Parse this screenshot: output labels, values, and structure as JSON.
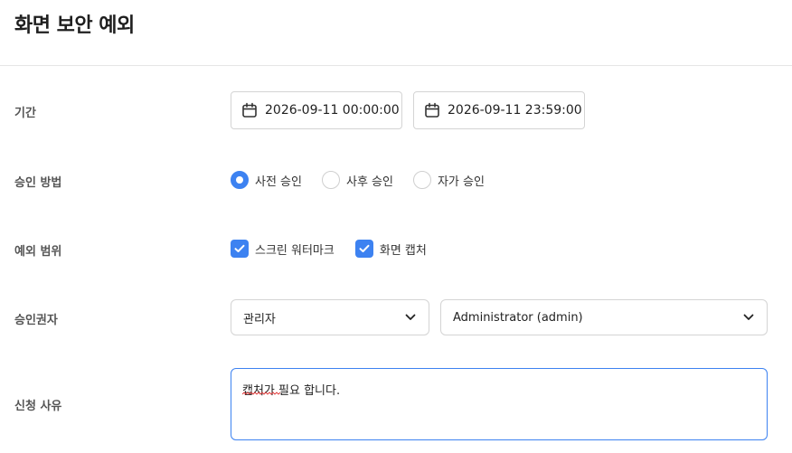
{
  "page": {
    "title": "화면 보안 예외"
  },
  "period": {
    "label": "기간",
    "start": "2026-09-11 00:00:00",
    "end": "2026-09-11 23:59:00"
  },
  "approval_method": {
    "label": "승인 방법",
    "options": [
      {
        "label": "사전 승인",
        "selected": true
      },
      {
        "label": "사후 승인",
        "selected": false
      },
      {
        "label": "자가 승인",
        "selected": false
      }
    ]
  },
  "exception_scope": {
    "label": "예외 범위",
    "options": [
      {
        "label": "스크린 워터마크",
        "checked": true
      },
      {
        "label": "화면 캡처",
        "checked": true
      }
    ]
  },
  "approver": {
    "label": "승인권자",
    "role_value": "관리자",
    "user_value": "Administrator (admin)"
  },
  "reason": {
    "label": "신청 사유",
    "value": "캡처가 필요 합니다."
  },
  "colors": {
    "accent": "#3d82f1",
    "border": "#d4d4d4",
    "label": "#555555"
  }
}
